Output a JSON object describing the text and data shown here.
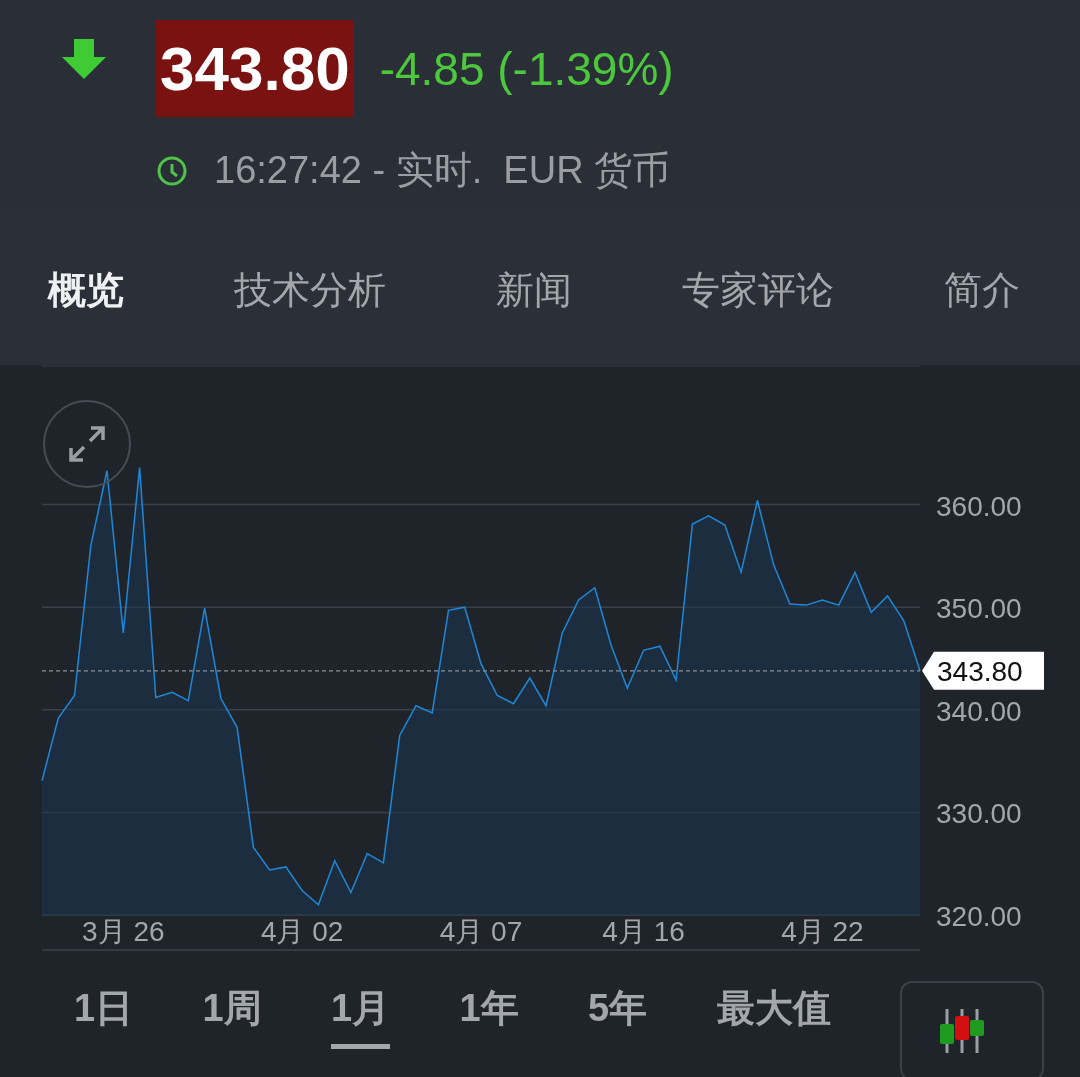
{
  "quote": {
    "falling": true,
    "price": "343.80",
    "change": "-4.85 (-1.39%)",
    "time_line": "16:27:42 - 实时.  EUR 货币"
  },
  "tabs": [
    {
      "label": "概览",
      "selected": true
    },
    {
      "label": "技术分析",
      "selected": false
    },
    {
      "label": "新闻",
      "selected": false
    },
    {
      "label": "专家评论",
      "selected": false
    },
    {
      "label": "简介",
      "selected": false
    }
  ],
  "chart": {
    "chart_data": {
      "type": "area",
      "grid": true,
      "ref_lines": [
        {
          "axis": "y",
          "value": 343.8,
          "label": "343.80",
          "color": "#8a9099"
        }
      ],
      "ylim": [
        316.6,
        373.5
      ],
      "categories": [
        null,
        null,
        null,
        null,
        null,
        "3月 26",
        null,
        null,
        null,
        null,
        null,
        null,
        null,
        null,
        null,
        null,
        "4月 02",
        null,
        null,
        null,
        null,
        null,
        null,
        null,
        null,
        null,
        null,
        "4月 07",
        null,
        null,
        null,
        null,
        null,
        null,
        null,
        null,
        null,
        "4月 16",
        null,
        null,
        null,
        null,
        null,
        null,
        null,
        null,
        null,
        null,
        "4月 22",
        null,
        null,
        null,
        null,
        null,
        null
      ],
      "series": [
        {
          "color": "#1e88d8",
          "values": [
            333.1,
            339.2,
            341.4,
            356,
            363.3,
            347.5,
            363.6,
            341.2,
            341.7,
            340.9,
            349.9,
            341.1,
            338.3,
            326.6,
            324.4,
            324.7,
            322.4,
            321,
            325.3,
            322.2,
            326,
            325.1,
            337.5,
            340.4,
            339.7,
            349.7,
            350,
            344.5,
            341.4,
            340.6,
            343.1,
            340.4,
            347.5,
            350.7,
            351.9,
            346.3,
            342.1,
            345.8,
            346.2,
            342.9,
            358.1,
            358.9,
            358,
            353.4,
            360.4,
            354.1,
            350.3,
            350.2,
            350.7,
            350.2,
            353.4,
            349.5,
            351.1,
            348.7,
            343.8
          ]
        }
      ],
      "yticks": [
        {
          "value": 320,
          "label": "320.00"
        },
        {
          "value": 330,
          "label": "330.00"
        },
        {
          "value": 340,
          "label": "340.00"
        },
        {
          "value": 350,
          "label": "350.00"
        },
        {
          "value": 360,
          "label": "360.00"
        }
      ]
    }
  },
  "ranges": [
    {
      "label": "1日",
      "selected": false
    },
    {
      "label": "1周",
      "selected": false
    },
    {
      "label": "1月",
      "selected": true
    },
    {
      "label": "1年",
      "selected": false
    },
    {
      "label": "5年",
      "selected": false
    },
    {
      "label": "最大值",
      "selected": false
    }
  ]
}
